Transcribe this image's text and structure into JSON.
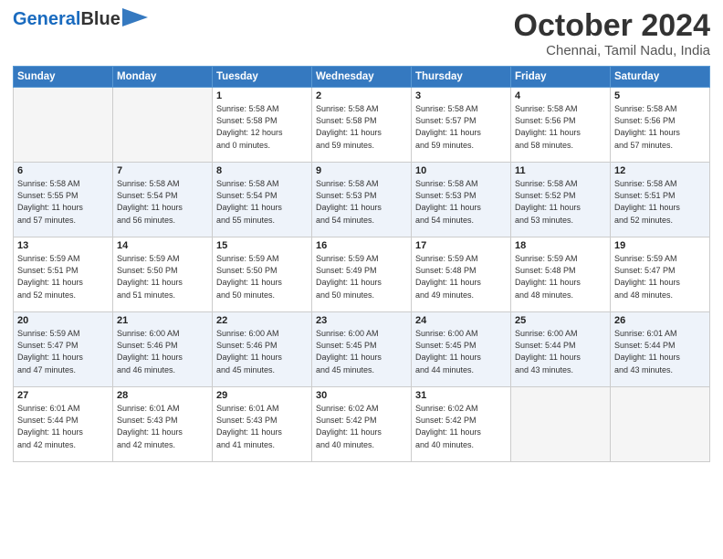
{
  "header": {
    "logo_line1": "General",
    "logo_line2": "Blue",
    "month": "October 2024",
    "location": "Chennai, Tamil Nadu, India"
  },
  "weekdays": [
    "Sunday",
    "Monday",
    "Tuesday",
    "Wednesday",
    "Thursday",
    "Friday",
    "Saturday"
  ],
  "weeks": [
    [
      {
        "day": "",
        "info": ""
      },
      {
        "day": "",
        "info": ""
      },
      {
        "day": "1",
        "info": "Sunrise: 5:58 AM\nSunset: 5:58 PM\nDaylight: 12 hours\nand 0 minutes."
      },
      {
        "day": "2",
        "info": "Sunrise: 5:58 AM\nSunset: 5:58 PM\nDaylight: 11 hours\nand 59 minutes."
      },
      {
        "day": "3",
        "info": "Sunrise: 5:58 AM\nSunset: 5:57 PM\nDaylight: 11 hours\nand 59 minutes."
      },
      {
        "day": "4",
        "info": "Sunrise: 5:58 AM\nSunset: 5:56 PM\nDaylight: 11 hours\nand 58 minutes."
      },
      {
        "day": "5",
        "info": "Sunrise: 5:58 AM\nSunset: 5:56 PM\nDaylight: 11 hours\nand 57 minutes."
      }
    ],
    [
      {
        "day": "6",
        "info": "Sunrise: 5:58 AM\nSunset: 5:55 PM\nDaylight: 11 hours\nand 57 minutes."
      },
      {
        "day": "7",
        "info": "Sunrise: 5:58 AM\nSunset: 5:54 PM\nDaylight: 11 hours\nand 56 minutes."
      },
      {
        "day": "8",
        "info": "Sunrise: 5:58 AM\nSunset: 5:54 PM\nDaylight: 11 hours\nand 55 minutes."
      },
      {
        "day": "9",
        "info": "Sunrise: 5:58 AM\nSunset: 5:53 PM\nDaylight: 11 hours\nand 54 minutes."
      },
      {
        "day": "10",
        "info": "Sunrise: 5:58 AM\nSunset: 5:53 PM\nDaylight: 11 hours\nand 54 minutes."
      },
      {
        "day": "11",
        "info": "Sunrise: 5:58 AM\nSunset: 5:52 PM\nDaylight: 11 hours\nand 53 minutes."
      },
      {
        "day": "12",
        "info": "Sunrise: 5:58 AM\nSunset: 5:51 PM\nDaylight: 11 hours\nand 52 minutes."
      }
    ],
    [
      {
        "day": "13",
        "info": "Sunrise: 5:59 AM\nSunset: 5:51 PM\nDaylight: 11 hours\nand 52 minutes."
      },
      {
        "day": "14",
        "info": "Sunrise: 5:59 AM\nSunset: 5:50 PM\nDaylight: 11 hours\nand 51 minutes."
      },
      {
        "day": "15",
        "info": "Sunrise: 5:59 AM\nSunset: 5:50 PM\nDaylight: 11 hours\nand 50 minutes."
      },
      {
        "day": "16",
        "info": "Sunrise: 5:59 AM\nSunset: 5:49 PM\nDaylight: 11 hours\nand 50 minutes."
      },
      {
        "day": "17",
        "info": "Sunrise: 5:59 AM\nSunset: 5:48 PM\nDaylight: 11 hours\nand 49 minutes."
      },
      {
        "day": "18",
        "info": "Sunrise: 5:59 AM\nSunset: 5:48 PM\nDaylight: 11 hours\nand 48 minutes."
      },
      {
        "day": "19",
        "info": "Sunrise: 5:59 AM\nSunset: 5:47 PM\nDaylight: 11 hours\nand 48 minutes."
      }
    ],
    [
      {
        "day": "20",
        "info": "Sunrise: 5:59 AM\nSunset: 5:47 PM\nDaylight: 11 hours\nand 47 minutes."
      },
      {
        "day": "21",
        "info": "Sunrise: 6:00 AM\nSunset: 5:46 PM\nDaylight: 11 hours\nand 46 minutes."
      },
      {
        "day": "22",
        "info": "Sunrise: 6:00 AM\nSunset: 5:46 PM\nDaylight: 11 hours\nand 45 minutes."
      },
      {
        "day": "23",
        "info": "Sunrise: 6:00 AM\nSunset: 5:45 PM\nDaylight: 11 hours\nand 45 minutes."
      },
      {
        "day": "24",
        "info": "Sunrise: 6:00 AM\nSunset: 5:45 PM\nDaylight: 11 hours\nand 44 minutes."
      },
      {
        "day": "25",
        "info": "Sunrise: 6:00 AM\nSunset: 5:44 PM\nDaylight: 11 hours\nand 43 minutes."
      },
      {
        "day": "26",
        "info": "Sunrise: 6:01 AM\nSunset: 5:44 PM\nDaylight: 11 hours\nand 43 minutes."
      }
    ],
    [
      {
        "day": "27",
        "info": "Sunrise: 6:01 AM\nSunset: 5:44 PM\nDaylight: 11 hours\nand 42 minutes."
      },
      {
        "day": "28",
        "info": "Sunrise: 6:01 AM\nSunset: 5:43 PM\nDaylight: 11 hours\nand 42 minutes."
      },
      {
        "day": "29",
        "info": "Sunrise: 6:01 AM\nSunset: 5:43 PM\nDaylight: 11 hours\nand 41 minutes."
      },
      {
        "day": "30",
        "info": "Sunrise: 6:02 AM\nSunset: 5:42 PM\nDaylight: 11 hours\nand 40 minutes."
      },
      {
        "day": "31",
        "info": "Sunrise: 6:02 AM\nSunset: 5:42 PM\nDaylight: 11 hours\nand 40 minutes."
      },
      {
        "day": "",
        "info": ""
      },
      {
        "day": "",
        "info": ""
      }
    ]
  ]
}
